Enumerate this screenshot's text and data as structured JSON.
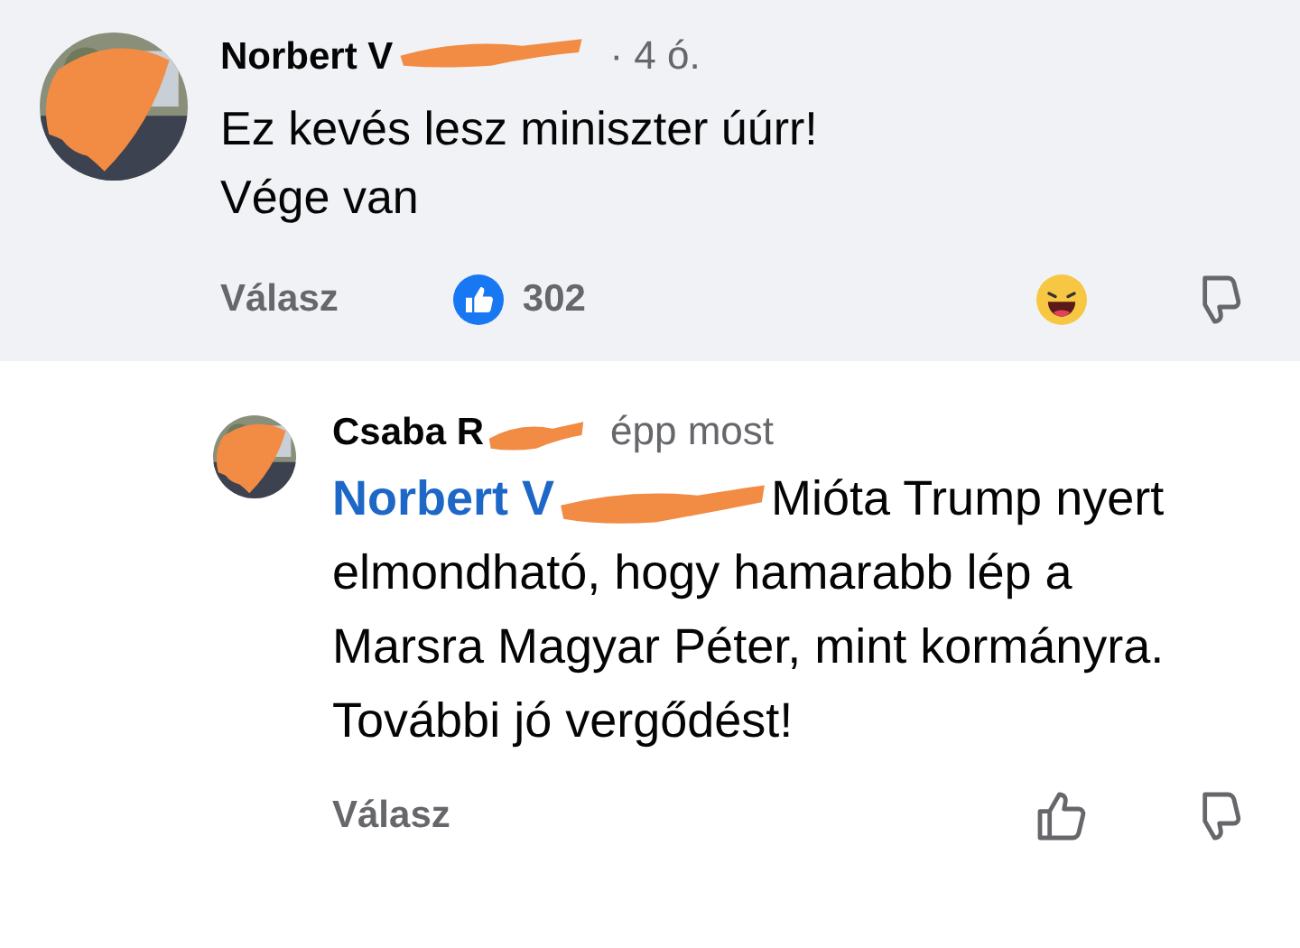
{
  "comments": [
    {
      "author": "Norbert V",
      "time": "· 4 ó.",
      "highlighted": true,
      "body": "Ez kevés lesz miniszter úúrr!\nVége van",
      "reply_label": "Válasz",
      "reaction_count": "302",
      "reacted": true,
      "reply": false
    },
    {
      "author": "Csaba R",
      "time": "épp most",
      "highlighted": false,
      "body": "Mióta Trump nyert elmondható, hogy hamarabb lép a Marsra Magyar Péter, mint kormányra. További jó vergődést!",
      "mention": "Norbert V",
      "reply_label": "Válasz",
      "reacted": false,
      "reply": true
    }
  ]
}
